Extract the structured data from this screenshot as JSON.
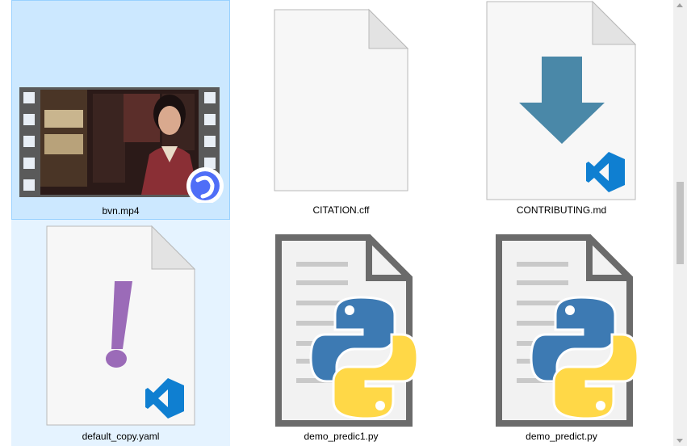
{
  "files": [
    {
      "name": "bvn.mp4",
      "icon": "video-thumbnail-icon",
      "state": "selected"
    },
    {
      "name": "CITATION.cff",
      "icon": "blank-file-icon",
      "state": "normal"
    },
    {
      "name": "CONTRIBUTING.md",
      "icon": "vscode-markdown-file-icon",
      "state": "normal"
    },
    {
      "name": "default_copy.yaml",
      "icon": "vscode-yaml-file-icon",
      "state": "hover"
    },
    {
      "name": "demo_predic1.py",
      "icon": "python-file-icon",
      "state": "normal"
    },
    {
      "name": "demo_predict.py",
      "icon": "python-file-icon",
      "state": "normal"
    }
  ],
  "colors": {
    "selected_bg": "#cce8ff",
    "selected_border": "#99d1ff",
    "hover_bg": "#e5f3ff",
    "python_blue": "#3d7ab3",
    "python_yellow": "#ffd847",
    "vscode_blue": "#0f7fd1",
    "yaml_purple": "#9b6bb8",
    "download_arrow": "#4a88a8"
  }
}
